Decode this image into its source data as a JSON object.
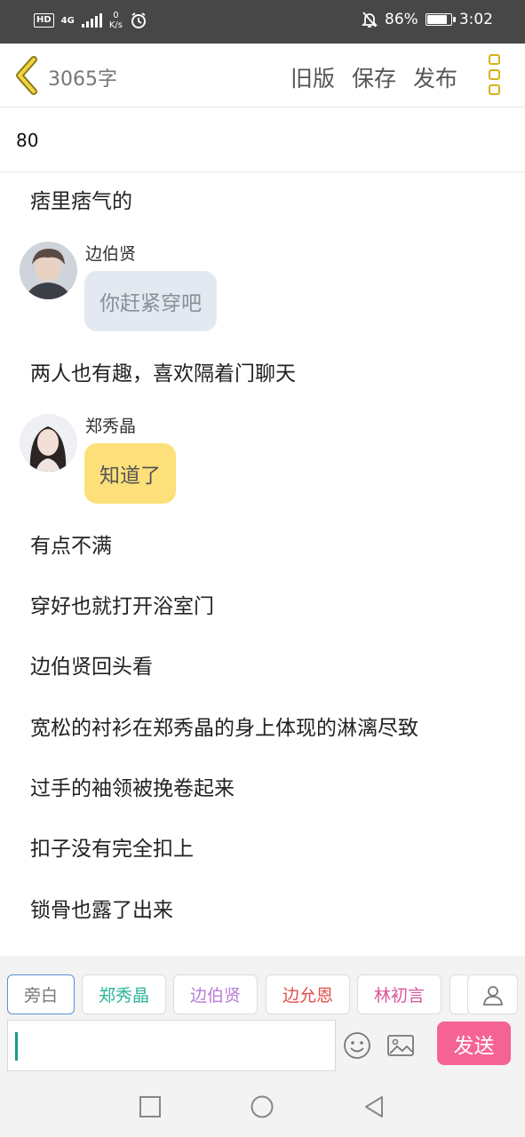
{
  "status_bar": {
    "hd": "HD",
    "network_type": "4G",
    "speed_value": "0",
    "speed_unit": "K/s",
    "battery": "86%",
    "battery_level": 0.86,
    "time": "3:02"
  },
  "header": {
    "word_count": "3065字",
    "old_version_label": "旧版",
    "save_label": "保存",
    "publish_label": "发布"
  },
  "chapter_title": "80",
  "content": {
    "items": [
      {
        "type": "narration",
        "text": "痞里痞气的"
      },
      {
        "type": "dialogue",
        "speaker": "边伯贤",
        "text": "你赶紧穿吧"
      },
      {
        "type": "narration",
        "text": "两人也有趣，喜欢隔着门聊天"
      },
      {
        "type": "dialogue",
        "speaker": "郑秀晶",
        "text": "知道了"
      },
      {
        "type": "narration",
        "text": "有点不满"
      },
      {
        "type": "narration",
        "text": "穿好也就打开浴室门"
      },
      {
        "type": "narration",
        "text": "边伯贤回头看"
      },
      {
        "type": "narration",
        "text": "宽松的衬衫在郑秀晶的身上体现的淋漓尽致"
      },
      {
        "type": "narration",
        "text": "过手的袖领被挽卷起来"
      },
      {
        "type": "narration",
        "text": "扣子没有完全扣上"
      },
      {
        "type": "narration",
        "text": "锁骨也露了出来"
      }
    ]
  },
  "editor": {
    "roles": [
      {
        "label": "旁白",
        "color": "#777777"
      },
      {
        "label": "郑秀晶",
        "color": "#2bb39a"
      },
      {
        "label": "边伯贤",
        "color": "#b77fd6"
      },
      {
        "label": "边允恩",
        "color": "#e0504a"
      },
      {
        "label": "林初言",
        "color": "#d9569a"
      }
    ],
    "input_value": "",
    "send_label": "发送"
  },
  "icons": {
    "back": "chevron-left-icon",
    "menu": "more-vertical-icon",
    "person": "person-icon",
    "emoji": "emoji-icon",
    "image": "image-icon",
    "nav_recent": "square-icon",
    "nav_home": "circle-icon",
    "nav_back": "triangle-back-icon"
  },
  "colors": {
    "accent_yellow": "#d6b21a",
    "bubble_grey": "#e4e9f1",
    "bubble_yellow": "#fde07a",
    "send_pink": "#f56395"
  }
}
